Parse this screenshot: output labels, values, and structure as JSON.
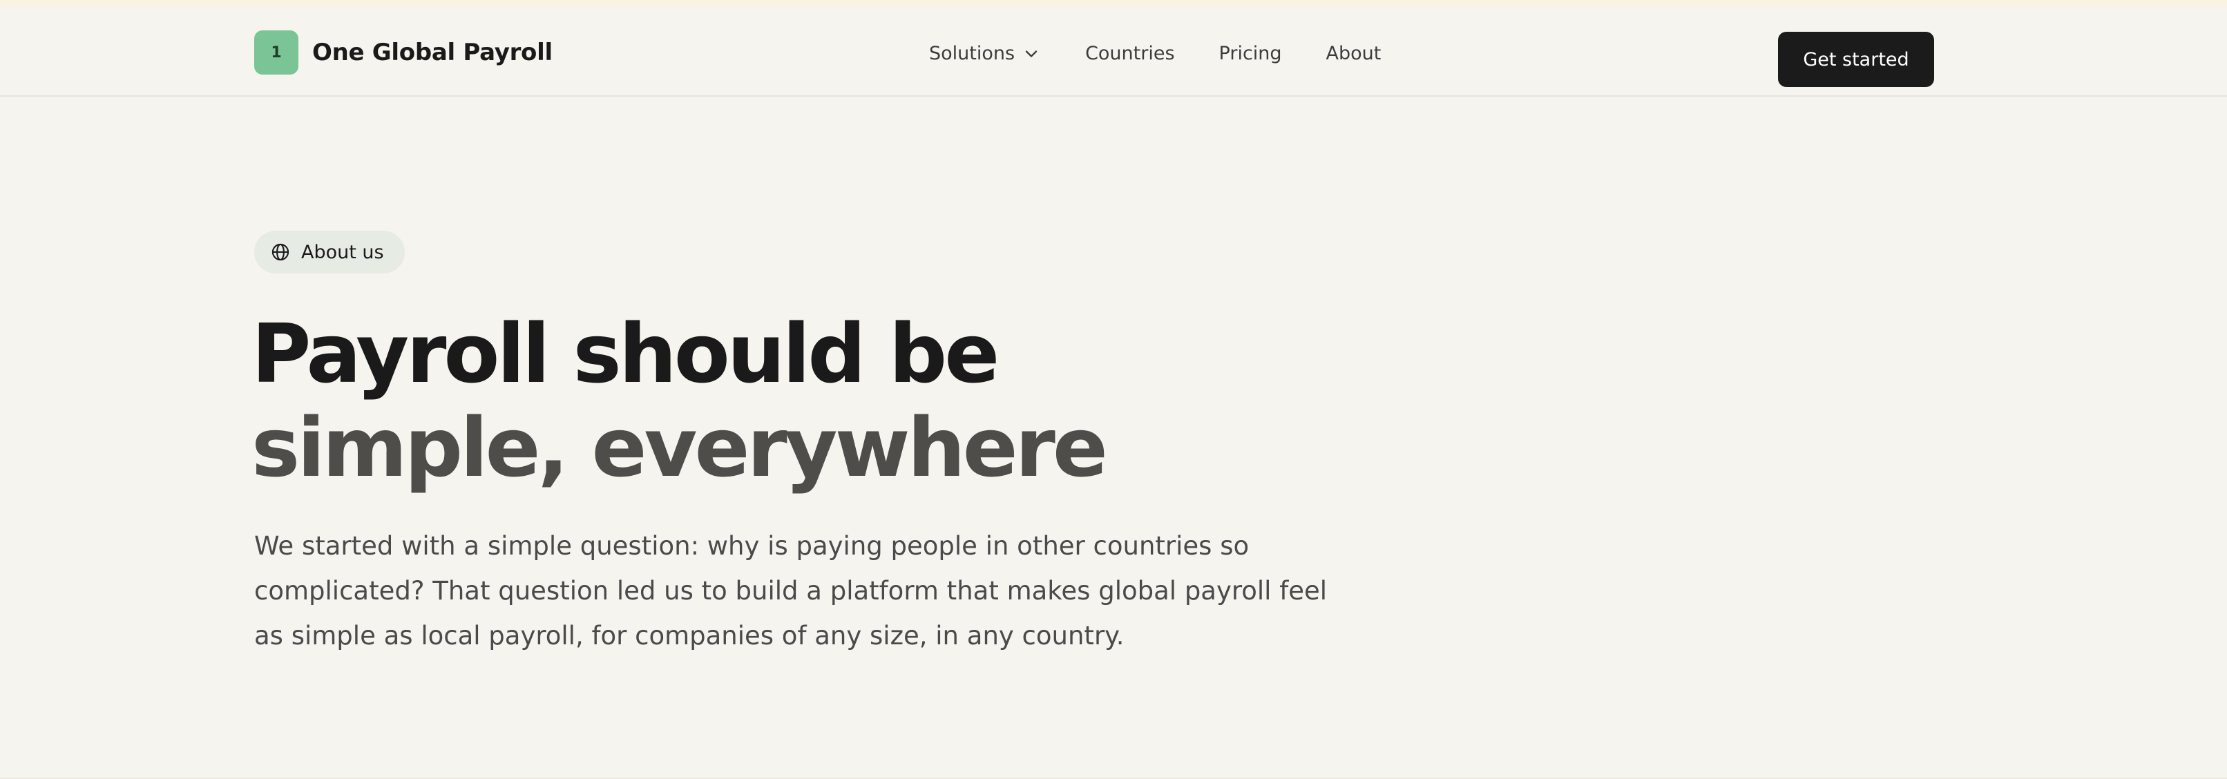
{
  "header": {
    "logo_text": "1",
    "brand": "One Global Payroll",
    "nav": [
      {
        "label": "Solutions",
        "has_dropdown": true,
        "icon": "chevron-down-icon"
      },
      {
        "label": "Countries"
      },
      {
        "label": "Pricing"
      },
      {
        "label": "About"
      }
    ],
    "cta_label": "Get started"
  },
  "hero": {
    "badge_icon": "globe-icon",
    "badge_label": "About us",
    "headline_line1": "Payroll should be",
    "headline_line2": "simple, everywhere",
    "intro": "We started with a simple question: why is paying people in other countries so complicated? That question led us to build a platform that makes global payroll feel as simple as local payroll, for companies of any size, in any country."
  },
  "colors": {
    "background": "#f6f4ef",
    "logo_green": "#7ac496",
    "cta_background": "#1b1b1b",
    "badge_background": "#e6ebe4",
    "headline_primary": "#1a1a1a",
    "headline_secondary": "#4e4d4a"
  }
}
